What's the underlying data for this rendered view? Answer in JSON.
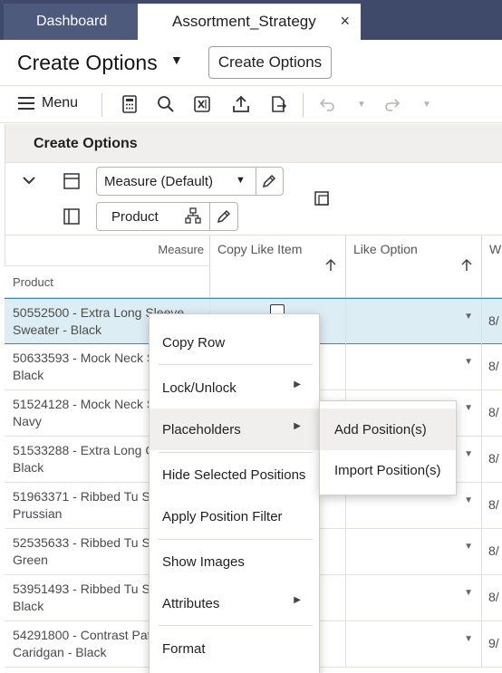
{
  "tabs": [
    {
      "label": "Dashboard"
    },
    {
      "label": "Assortment_Strategy",
      "close": "×"
    }
  ],
  "title": {
    "text": "Create Options",
    "caret": "▼",
    "button_label": "Create Options"
  },
  "toolbar": {
    "menu_label": "Menu",
    "icons": [
      "calculator-icon",
      "search-icon",
      "excel-export-icon",
      "upload-icon",
      "export-file-icon",
      "undo-icon",
      "undo-dropdown-icon",
      "redo-icon",
      "redo-dropdown-icon"
    ]
  },
  "panel": {
    "title": "Create Options",
    "measure_field": "Measure (Default)",
    "product_field": "Product"
  },
  "grid": {
    "header_measure": "Measure",
    "header_product": "Product",
    "columns": [
      "Copy Like Item",
      "Like Option",
      "W"
    ],
    "rows": [
      {
        "product": "50552500 - Extra Long Sleeve Sweater - Black",
        "col3": "8/"
      },
      {
        "product": "50633593 - Mock Neck Sweater - Black",
        "col3": "8/"
      },
      {
        "product": "51524128 - Mock Neck Sweater - Navy",
        "col3": "8/"
      },
      {
        "product": "51533288 - Extra Long Cardigan - Black",
        "col3": "8/"
      },
      {
        "product": "51963371 - Ribbed Tu Sweater - Prussian",
        "col3": "8/"
      },
      {
        "product": "52535633 - Ribbed Tu Sweater - Green",
        "col3": "8/"
      },
      {
        "product": "53951493 - Ribbed Tu Sweater - Black",
        "col3": "8/"
      },
      {
        "product": "54291800 - Contrast Patch Caridgan - Black",
        "col3": "9/"
      }
    ]
  },
  "context_menu": {
    "items": [
      {
        "label": "Copy Row"
      },
      {
        "label": "Lock/Unlock",
        "submenu": true
      },
      {
        "label": "Placeholders",
        "submenu": true
      },
      {
        "label": "Hide Selected Positions"
      },
      {
        "label": "Apply Position Filter"
      },
      {
        "label": "Show Images"
      },
      {
        "label": "Attributes",
        "submenu": true
      },
      {
        "label": "Format"
      }
    ]
  },
  "submenu": {
    "items": [
      {
        "label": "Add Position(s)"
      },
      {
        "label": "Import Position(s)"
      }
    ]
  },
  "colors": {
    "tabbar": "#3f4a6b",
    "selected_row": "#dcedf4",
    "selection_border": "#3f86b5"
  }
}
